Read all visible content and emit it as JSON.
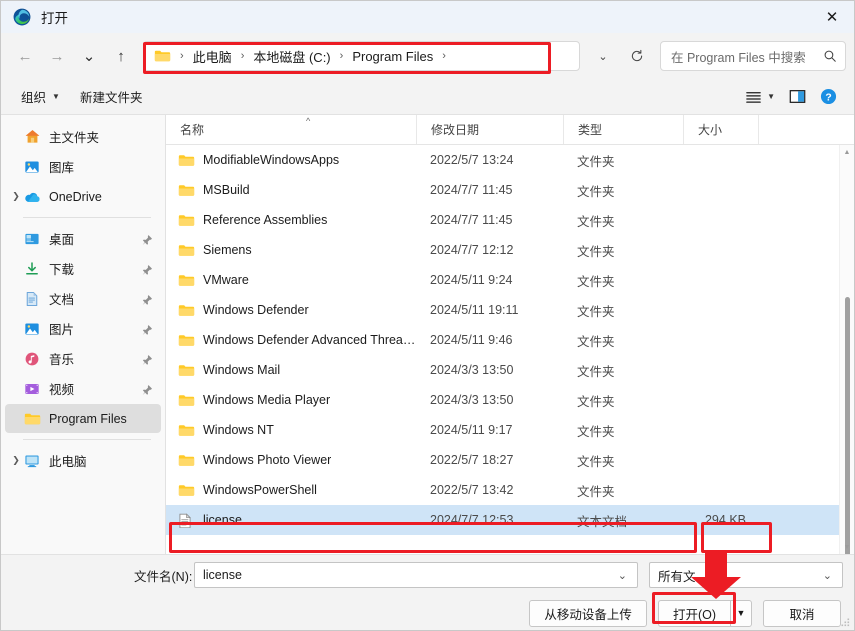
{
  "window": {
    "title": "打开",
    "app_icon": "edge-logo-icon",
    "close_label": "✕"
  },
  "nav": {
    "back": "←",
    "forward": "→",
    "recent": "⌄",
    "up": "↑",
    "breadcrumb": [
      "此电脑",
      "本地磁盘 (C:)",
      "Program Files"
    ],
    "breadcrumb_trailing_sep": "›",
    "dropdown": "⌄",
    "refresh": "⟳",
    "search_placeholder": "在 Program Files 中搜索",
    "search_value": ""
  },
  "commandbar": {
    "organize": "组织",
    "new_folder": "新建文件夹",
    "view_label": "view-list",
    "preview_label": "preview-pane",
    "help_label": "?"
  },
  "sidebar": {
    "items": [
      {
        "label": "主文件夹",
        "icon": "home-icon",
        "chevron": false,
        "pinned": false,
        "selected": false
      },
      {
        "label": "图库",
        "icon": "gallery-icon",
        "chevron": false,
        "pinned": false,
        "selected": false
      },
      {
        "label": "OneDrive",
        "icon": "onedrive-icon",
        "chevron": true,
        "pinned": false,
        "selected": false
      },
      {
        "separator": true
      },
      {
        "label": "桌面",
        "icon": "desktop-icon",
        "chevron": false,
        "pinned": true,
        "selected": false
      },
      {
        "label": "下载",
        "icon": "downloads-icon",
        "chevron": false,
        "pinned": true,
        "selected": false
      },
      {
        "label": "文档",
        "icon": "documents-icon",
        "chevron": false,
        "pinned": true,
        "selected": false
      },
      {
        "label": "图片",
        "icon": "pictures-icon",
        "chevron": false,
        "pinned": true,
        "selected": false
      },
      {
        "label": "音乐",
        "icon": "music-icon",
        "chevron": false,
        "pinned": true,
        "selected": false
      },
      {
        "label": "视频",
        "icon": "videos-icon",
        "chevron": false,
        "pinned": true,
        "selected": false
      },
      {
        "label": "Program Files",
        "icon": "folder-icon",
        "chevron": false,
        "pinned": false,
        "selected": true
      },
      {
        "separator": true
      },
      {
        "label": "此电脑",
        "icon": "this-pc-icon",
        "chevron": true,
        "pinned": false,
        "selected": false
      }
    ]
  },
  "filelist": {
    "columns": [
      "名称",
      "修改日期",
      "类型",
      "大小"
    ],
    "sort_indicator": "^",
    "rows": [
      {
        "name": "ModifiableWindowsApps",
        "date": "2022/5/7 13:24",
        "type": "文件夹",
        "size": "",
        "icon": "folder-icon",
        "selected": false
      },
      {
        "name": "MSBuild",
        "date": "2024/7/7 11:45",
        "type": "文件夹",
        "size": "",
        "icon": "folder-icon",
        "selected": false
      },
      {
        "name": "Reference Assemblies",
        "date": "2024/7/7 11:45",
        "type": "文件夹",
        "size": "",
        "icon": "folder-icon",
        "selected": false
      },
      {
        "name": "Siemens",
        "date": "2024/7/7 12:12",
        "type": "文件夹",
        "size": "",
        "icon": "folder-icon",
        "selected": false
      },
      {
        "name": "VMware",
        "date": "2024/5/11 9:24",
        "type": "文件夹",
        "size": "",
        "icon": "folder-icon",
        "selected": false
      },
      {
        "name": "Windows Defender",
        "date": "2024/5/11 19:11",
        "type": "文件夹",
        "size": "",
        "icon": "folder-icon",
        "selected": false
      },
      {
        "name": "Windows Defender Advanced Threat ...",
        "date": "2024/5/11 9:46",
        "type": "文件夹",
        "size": "",
        "icon": "folder-icon",
        "selected": false
      },
      {
        "name": "Windows Mail",
        "date": "2024/3/3 13:50",
        "type": "文件夹",
        "size": "",
        "icon": "folder-icon",
        "selected": false
      },
      {
        "name": "Windows Media Player",
        "date": "2024/3/3 13:50",
        "type": "文件夹",
        "size": "",
        "icon": "folder-icon",
        "selected": false
      },
      {
        "name": "Windows NT",
        "date": "2024/5/11 9:17",
        "type": "文件夹",
        "size": "",
        "icon": "folder-icon",
        "selected": false
      },
      {
        "name": "Windows Photo Viewer",
        "date": "2022/5/7 18:27",
        "type": "文件夹",
        "size": "",
        "icon": "folder-icon",
        "selected": false
      },
      {
        "name": "WindowsPowerShell",
        "date": "2022/5/7 13:42",
        "type": "文件夹",
        "size": "",
        "icon": "folder-icon",
        "selected": false
      },
      {
        "name": "license",
        "date": "2024/7/7 12:53",
        "type": "文本文档",
        "size": "294 KB",
        "icon": "text-file-icon",
        "selected": true
      }
    ]
  },
  "footer": {
    "filename_label": "文件名(N):",
    "filename_value": "license",
    "filename_placeholder": "",
    "filetype_value": "所有文",
    "upload_button": "从移动设备上传",
    "open_button": "打开(O)",
    "open_dropdown": "▼",
    "cancel_button": "取消"
  },
  "annotations": {
    "highlight_color": "#ec1c24",
    "boxes": [
      "address-bar",
      "license-row",
      "license-size",
      "open-button"
    ],
    "arrow": "points-to-open-button"
  }
}
